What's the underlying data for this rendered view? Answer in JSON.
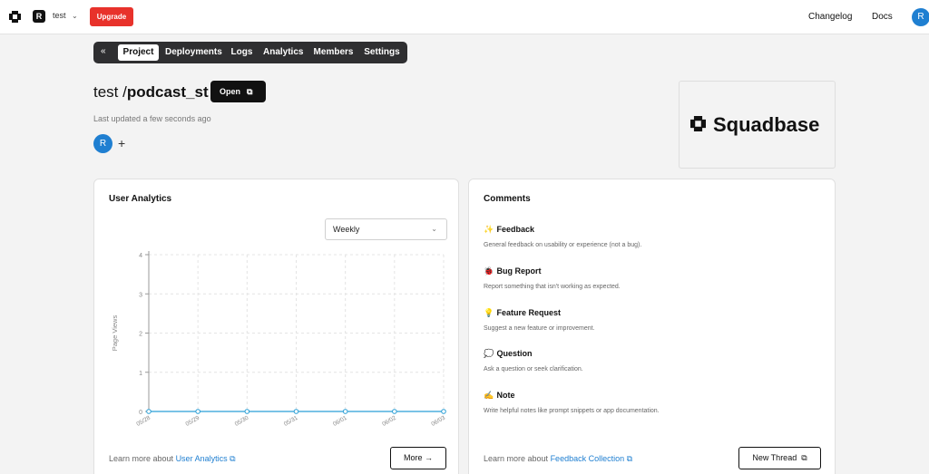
{
  "topbar": {
    "workspace_initial": "R",
    "workspace_name": "test",
    "upgrade_label": "Upgrade",
    "changelog_label": "Changelog",
    "docs_label": "Docs",
    "user_initial": "R"
  },
  "tabs": {
    "collapse": "«",
    "items": [
      "Project",
      "Deployments",
      "Logs",
      "Analytics",
      "Members",
      "Settings"
    ],
    "active": "Project"
  },
  "project": {
    "owner": "test",
    "separator": "/",
    "name": "podcast_st",
    "open_label": "Open",
    "last_updated": "Last updated a few seconds ago",
    "member_initial": "R",
    "add_member": "+"
  },
  "brand": {
    "name": "Squadbase"
  },
  "analytics": {
    "title": "User Analytics",
    "period_select": "Weekly",
    "learn_prefix": "Learn more about",
    "learn_link": "User Analytics",
    "more_label": "More →"
  },
  "chart_data": {
    "type": "line",
    "ylabel": "Page Views",
    "xlabel": "",
    "title": "",
    "x": [
      "05/28",
      "05/29",
      "05/30",
      "05/31",
      "06/01",
      "06/02",
      "06/03"
    ],
    "values": [
      0,
      0,
      0,
      0,
      0,
      0,
      0
    ],
    "ylim": [
      0,
      4
    ],
    "yticks": [
      "0",
      "1",
      "2",
      "3",
      "4"
    ],
    "grid": true,
    "color": "#2a9fd6"
  },
  "comments": {
    "title": "Comments",
    "items": [
      {
        "icon": "✨",
        "title": "Feedback",
        "desc": "General feedback on usability or experience (not a bug)."
      },
      {
        "icon": "🐞",
        "title": "Bug Report",
        "desc": "Report something that isn't working as expected."
      },
      {
        "icon": "💡",
        "title": "Feature Request",
        "desc": "Suggest a new feature or improvement."
      },
      {
        "icon": "💭",
        "title": "Question",
        "desc": "Ask a question or seek clarification."
      },
      {
        "icon": "✍",
        "title": "Note",
        "desc": "Write helpful notes like prompt snippets or app documentation."
      }
    ],
    "learn_prefix": "Learn more about",
    "learn_link": "Feedback Collection",
    "new_thread_label": "New Thread"
  },
  "colors": {
    "accent": "#1f7fd1",
    "upgrade": "#e8322b",
    "line": "#2a9fd6"
  }
}
